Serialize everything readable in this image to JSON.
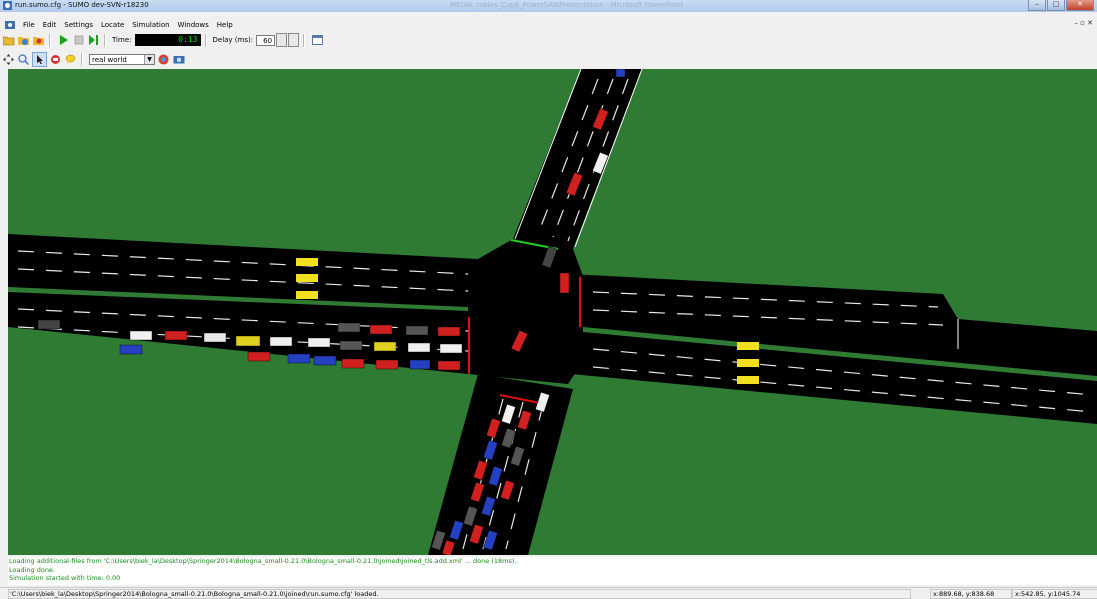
{
  "window": {
    "title": "run.sumo.cfg - SUMO dev-SVN-r18230",
    "background_title": "MEDIA_tables_Cupé_PowerSAWPresentation - Microsoft PowerPoint"
  },
  "menu": {
    "items": [
      "File",
      "Edit",
      "Settings",
      "Locate",
      "Simulation",
      "Windows",
      "Help"
    ]
  },
  "toolbar": {
    "time_label": "Time:",
    "time_value": "0:13",
    "delay_label": "Delay (ms):",
    "delay_value": "60",
    "icons": [
      "open-config-icon",
      "open-network-icon",
      "reload-icon",
      "play-icon",
      "stop-icon",
      "step-icon",
      "new-view-icon"
    ]
  },
  "view_toolbar": {
    "scheme_value": "real world",
    "icons": [
      "recenter-icon",
      "locate-junction-icon",
      "locate-edge-icon",
      "locate-vehicle-icon",
      "locate-poi-icon",
      "edit-coloring-icon",
      "screenshot-icon"
    ]
  },
  "scale": {
    "start": "0m",
    "end": "10m"
  },
  "log": [
    "Loading additional-files from 'C:\\Users\\biek_la\\Desktop\\Springer2014\\Bologna_small-0.21.0\\Bologna_small-0.21.0\\joined\\joined_tls.add.xml' ... done (18ms).",
    "Loading done.",
    "Simulation started with time: 0.00"
  ],
  "status": {
    "message": "'C:\\Users\\biek_la\\Desktop\\Springer2014\\Bologna_small-0.21.0\\Bologna_small-0.21.0\\joined\\run.sumo.cfg' loaded.",
    "coord1": "x:889.68, y:838.68",
    "coord2": "x:542.85, y:1045.74"
  },
  "colors": {
    "grass": "#2f7b34",
    "road": "#000000",
    "green_light": "#22cc22",
    "red_light": "#e01010",
    "time_text": "#00e000",
    "log_text": "#1a8a1a"
  }
}
